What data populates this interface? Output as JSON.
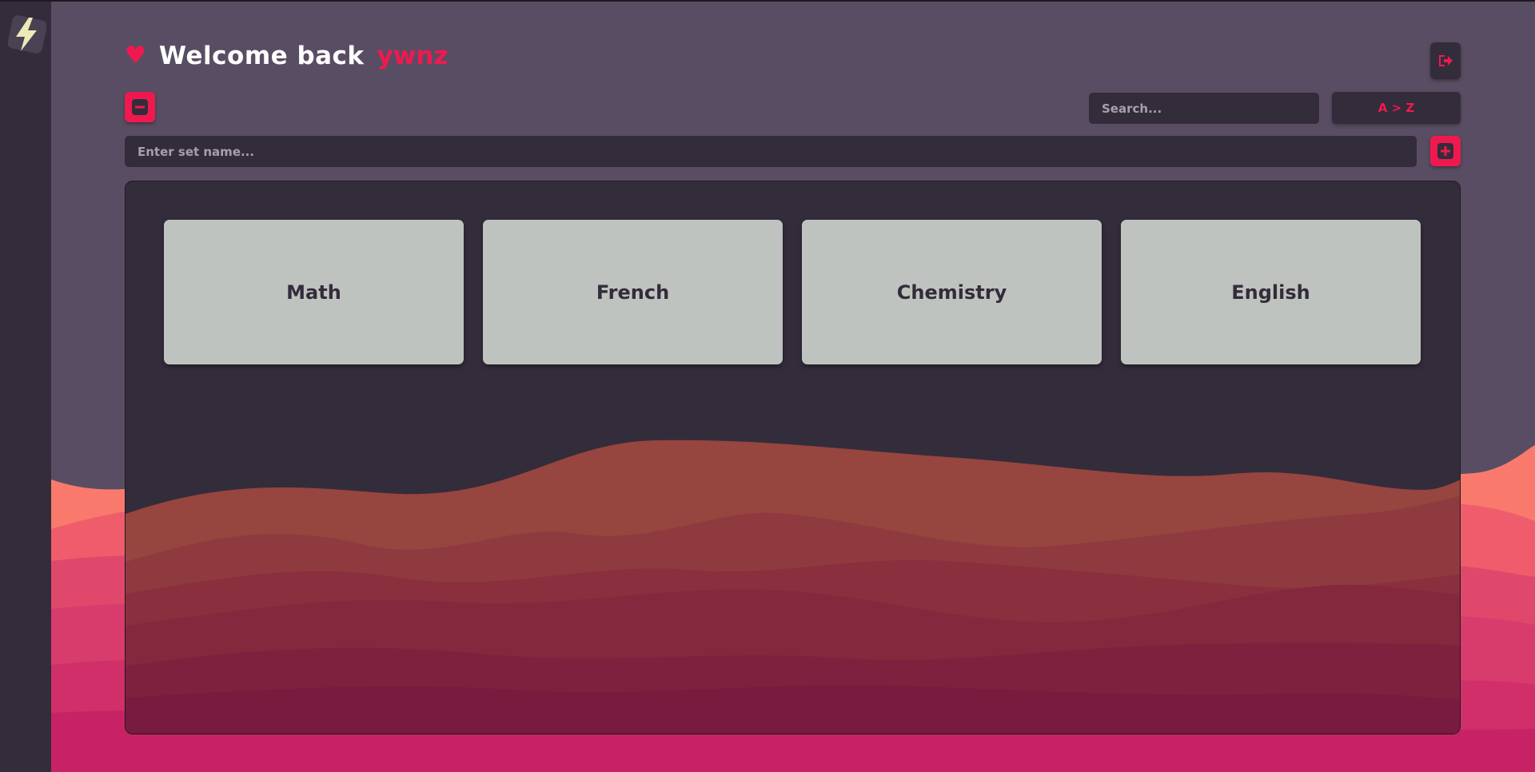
{
  "header": {
    "welcome_text": "Welcome back",
    "username": "ywnz"
  },
  "toolbar": {
    "search_placeholder": "Search...",
    "sort_label": "A > Z",
    "set_name_placeholder": "Enter set name..."
  },
  "sets": [
    {
      "label": "Math"
    },
    {
      "label": "French"
    },
    {
      "label": "Chemistry"
    },
    {
      "label": "English"
    }
  ],
  "icons": {
    "logo": "lightning-bolt-icon",
    "heart": "heart-icon",
    "logout": "logout-icon",
    "collapse": "minus-icon",
    "add": "plus-icon"
  },
  "colors": {
    "accent": "#f0194f",
    "background": "#594d63",
    "panel": "#332c3b",
    "card": "#bfc3bf",
    "logo_bolt": "#eeeab8"
  }
}
